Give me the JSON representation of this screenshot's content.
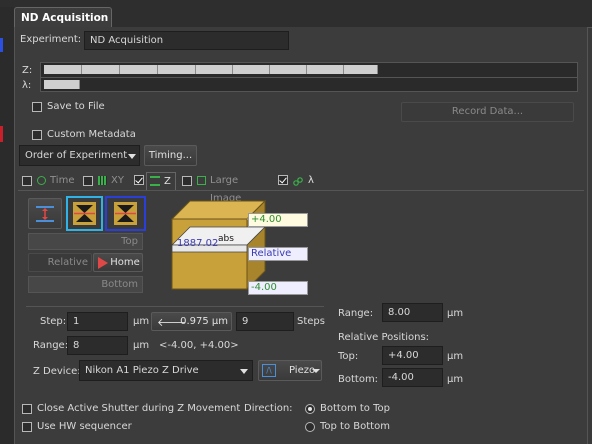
{
  "window": {
    "tab_title": "ND Acquisition"
  },
  "experiment": {
    "label": "Experiment:",
    "value": "ND Acquisition"
  },
  "tracks": {
    "z_label": "Z:",
    "lambda_label": "λ:"
  },
  "save": {
    "save_to_file": "Save to File",
    "record_data": "Record Data...",
    "custom_metadata": "Custom Metadata"
  },
  "order": {
    "dropdown_value": "Order of Experiment",
    "timing_button": "Timing..."
  },
  "subtabs": {
    "time": "Time",
    "xy": "XY",
    "z": "Z",
    "large_image": "Large Image",
    "lambda": "λ"
  },
  "zpanel": {
    "top_label": "Top",
    "relative_label": "Relative",
    "home_label": "Home",
    "bottom_label": "Bottom",
    "cube_top": "+4.00",
    "cube_center": "1887.02",
    "cube_abs": "abs",
    "cube_relative": "Relative",
    "cube_bottom": "-4.00"
  },
  "step": {
    "step_label": "Step:",
    "step_value": "1",
    "unit": "µm",
    "computed": "0.975 µm",
    "steps_value": "9",
    "steps_label": "Steps",
    "range_label": "Range:",
    "range_value": "8",
    "range_text": "<-4.00, +4.00>",
    "zdevice_label": "Z Device:",
    "zdevice_value": "Nikon A1 Piezo Z Drive",
    "piezo_label": "Piezo"
  },
  "right": {
    "range_label": "Range:",
    "range_value": "8.00",
    "unit": "µm",
    "rel_pos_label": "Relative Positions:",
    "top_label": "Top:",
    "top_value": "+4.00",
    "bottom_label": "Bottom:",
    "bottom_value": "-4.00"
  },
  "options": {
    "close_shutter": "Close Active Shutter during Z Movement",
    "use_hw": "Use HW sequencer",
    "direction_label": "Direction:",
    "bottom_to_top": "Bottom to Top",
    "top_to_bottom": "Top to Bottom"
  },
  "colors": {
    "cube_gold": "#c9a13a",
    "green_label": "#2f8f2f",
    "blue_label": "#3a3ab0",
    "sel_cyan": "#2fb3e6",
    "sel_blue": "#2a3fd8",
    "home_red": "#e04848"
  }
}
